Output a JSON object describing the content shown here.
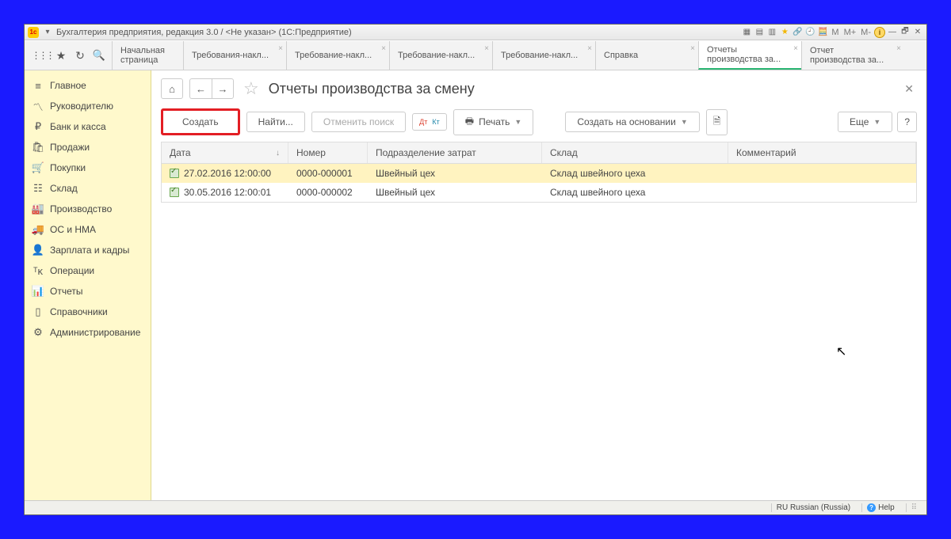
{
  "window_title": "Бухгалтерия предприятия, редакция 3.0 / <Не указан>   (1С:Предприятие)",
  "title_buttons": {
    "M": "M",
    "Mplus": "M+",
    "Mminus": "M-"
  },
  "tabs": {
    "start_l1": "Начальная",
    "start_l2": "страница",
    "t1": "Требования-накл...",
    "t2": "Требование-накл...",
    "t3": "Требование-накл...",
    "t4": "Требование-накл...",
    "t5": "Справка",
    "t6_l1": "Отчеты",
    "t6_l2": "производства за...",
    "t7_l1": "Отчет",
    "t7_l2": "производства за..."
  },
  "sidebar": [
    {
      "icon": "≡",
      "label": "Главное"
    },
    {
      "icon": "〽",
      "label": "Руководителю"
    },
    {
      "icon": "₽",
      "label": "Банк и касса"
    },
    {
      "icon": "🛍",
      "label": "Продажи"
    },
    {
      "icon": "🛒",
      "label": "Покупки"
    },
    {
      "icon": "☷",
      "label": "Склад"
    },
    {
      "icon": "🏭",
      "label": "Производство"
    },
    {
      "icon": "🚚",
      "label": "ОС и НМА"
    },
    {
      "icon": "👤",
      "label": "Зарплата и кадры"
    },
    {
      "icon": "ᵀᴋ",
      "label": "Операции"
    },
    {
      "icon": "📊",
      "label": "Отчеты"
    },
    {
      "icon": "▯",
      "label": "Справочники"
    },
    {
      "icon": "⚙",
      "label": "Администрирование"
    }
  ],
  "page": {
    "title": "Отчеты производства за смену"
  },
  "toolbar": {
    "create": "Создать",
    "find": "Найти...",
    "cancel_search": "Отменить поиск",
    "print": "Печать",
    "create_based": "Создать на основании",
    "more": "Еще",
    "help": "?"
  },
  "table": {
    "headers": {
      "date": "Дата",
      "num": "Номер",
      "subdiv": "Подразделение затрат",
      "sklad": "Склад",
      "comment": "Комментарий"
    },
    "sort_arrow": "↓",
    "rows": [
      {
        "date": "27.02.2016 12:00:00",
        "num": "0000-000001",
        "subdiv": "Швейный цех",
        "sklad": "Склад швейного цеха",
        "selected": true
      },
      {
        "date": "30.05.2016 12:00:01",
        "num": "0000-000002",
        "subdiv": "Швейный цех",
        "sklad": "Склад швейного цеха",
        "selected": false
      }
    ]
  },
  "status": {
    "lang": "RU Russian (Russia)",
    "help": "Help"
  }
}
